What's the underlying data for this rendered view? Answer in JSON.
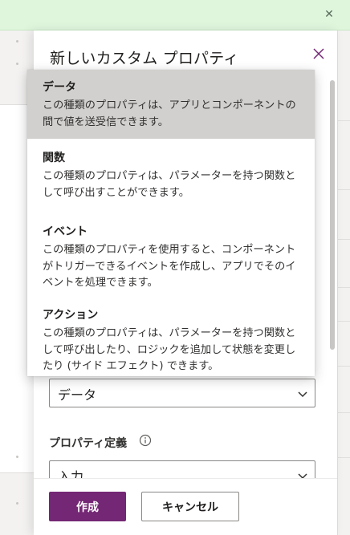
{
  "banner": {
    "close_glyph": "✕"
  },
  "panel": {
    "title": "新しいカスタム プロパティ",
    "data_type_value": "データ",
    "property_definition_label": "プロパティ定義",
    "property_definition_value": "入力"
  },
  "dropdown": {
    "options": [
      {
        "title": "データ",
        "desc": "この種類のプロパティは、アプリとコンポーネントの間で値を送受信できます。",
        "selected": true
      },
      {
        "title": "関数",
        "desc": "この種類のプロパティは、パラメーターを持つ関数として呼び出すことができます。",
        "selected": false
      },
      {
        "title": "イベント",
        "desc": "この種類のプロパティを使用すると、コンポーネントがトリガーできるイベントを作成し、アプリでそのイベントを処理できます。",
        "selected": false
      },
      {
        "title": "アクション",
        "desc": "この種類のプロパティは、パラメーターを持つ関数として呼び出したり、ロジックを追加して状態を変更したり (サイド エフェクト) できます。",
        "selected": false
      }
    ]
  },
  "footer": {
    "create_label": "作成",
    "cancel_label": "キャンセル"
  },
  "colors": {
    "primary": "#742774",
    "banner": "#dff6dd",
    "selected_option": "#d2d0ce"
  }
}
